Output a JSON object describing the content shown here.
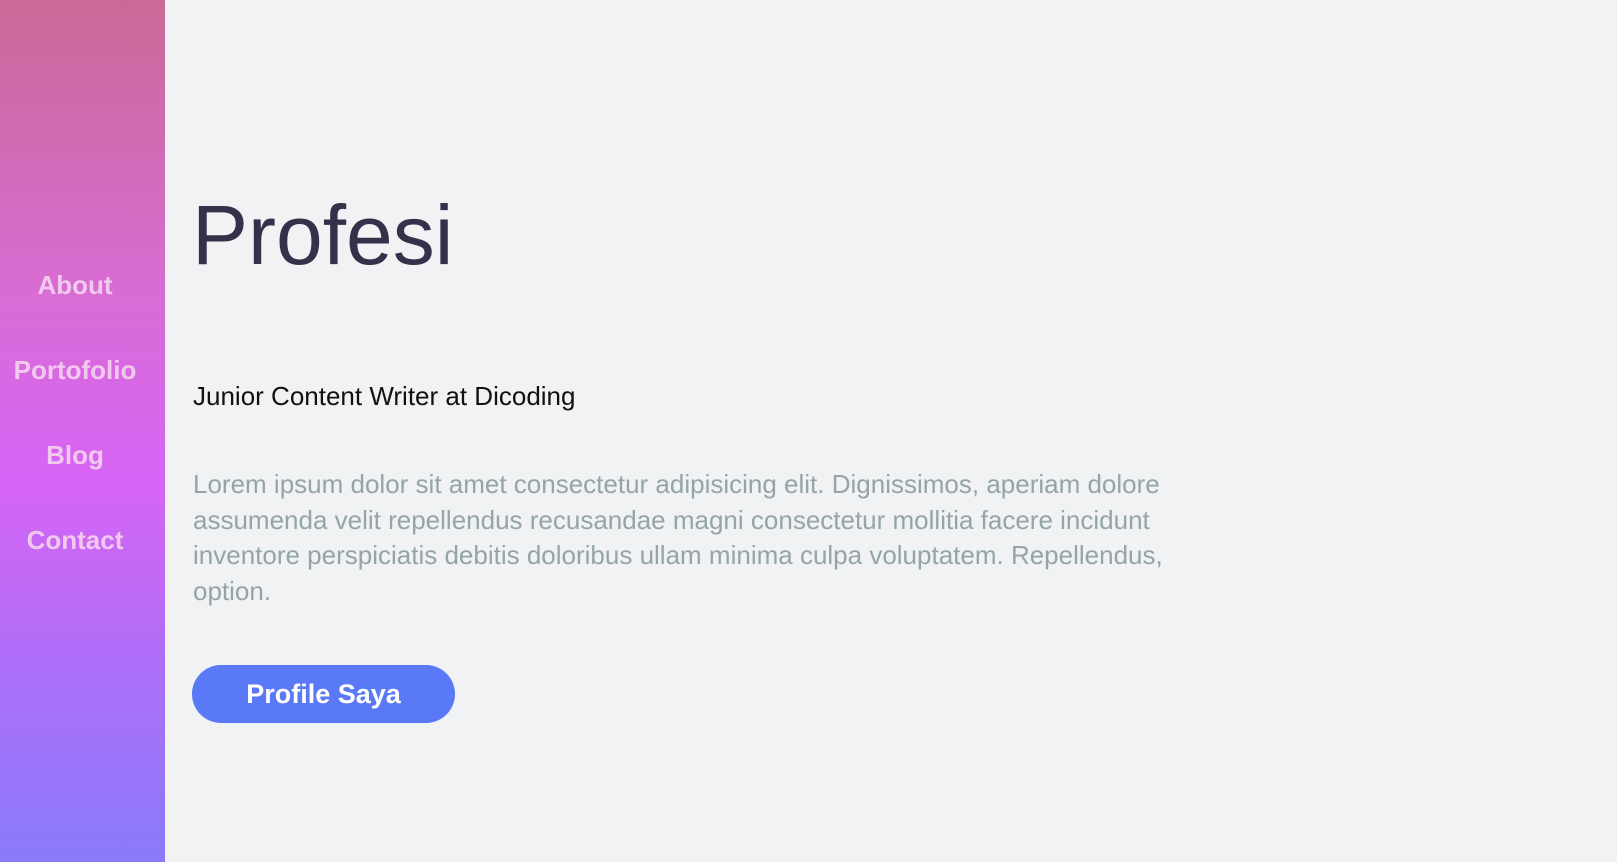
{
  "sidebar": {
    "items": [
      {
        "label": "About"
      },
      {
        "label": "Portofolio"
      },
      {
        "label": "Blog"
      },
      {
        "label": "Contact"
      }
    ]
  },
  "main": {
    "title": "Profesi",
    "subtitle": "Junior Content Writer at Dicoding",
    "description": "Lorem ipsum dolor sit amet consectetur adipisicing elit. Dignissimos, aperiam dolore assumenda velit repellendus recusandae magni consectetur mollitia facere incidunt inventore perspiciatis debitis doloribus ullam minima culpa voluptatem. Repellendus, option.",
    "button_label": "Profile Saya"
  },
  "colors": {
    "sidebar_gradient_top": "#c96a96",
    "sidebar_gradient_mid": "#d864f5",
    "sidebar_gradient_bottom": "#8a7afa",
    "nav_text": "#f2c8ee",
    "title_text": "#35314a",
    "description_text": "#95a5a6",
    "button_bg": "#5a79f6",
    "page_bg": "#f0f2f4"
  }
}
